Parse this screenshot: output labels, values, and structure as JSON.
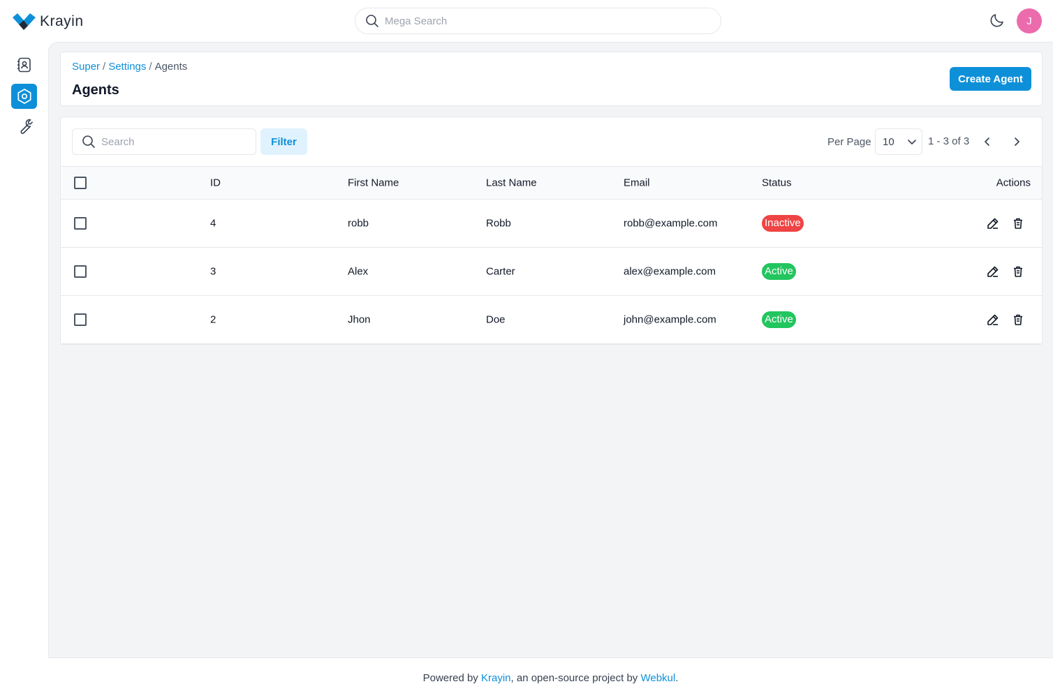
{
  "app": {
    "name": "Krayin"
  },
  "header": {
    "search_placeholder": "Mega Search",
    "avatar_initial": "J"
  },
  "sidebar": {
    "items": [
      {
        "icon": "contacts-icon",
        "active": false
      },
      {
        "icon": "settings-icon",
        "active": true
      },
      {
        "icon": "wrench-icon",
        "active": false
      }
    ]
  },
  "breadcrumb": {
    "super": "Super",
    "settings": "Settings",
    "current": "Agents",
    "separator": "/"
  },
  "page": {
    "title": "Agents",
    "create_button": "Create Agent"
  },
  "toolbar": {
    "search_placeholder": "Search",
    "filter_label": "Filter",
    "per_page_label": "Per Page",
    "per_page_value": "10",
    "page_info": "1 - 3 of 3"
  },
  "table": {
    "columns": {
      "id": "ID",
      "first_name": "First Name",
      "last_name": "Last Name",
      "email": "Email",
      "status": "Status",
      "actions": "Actions"
    },
    "rows": [
      {
        "id": "4",
        "first_name": "robb",
        "last_name": "Robb",
        "email": "robb@example.com",
        "status": "Inactive"
      },
      {
        "id": "3",
        "first_name": "Alex",
        "last_name": "Carter",
        "email": "alex@example.com",
        "status": "Active"
      },
      {
        "id": "2",
        "first_name": "Jhon",
        "last_name": "Doe",
        "email": "john@example.com",
        "status": "Active"
      }
    ]
  },
  "footer": {
    "prefix": "Powered by ",
    "krayin": "Krayin",
    "middle": ", an open-source project by ",
    "webkul": "Webkul",
    "suffix": "."
  },
  "colors": {
    "accent": "#0e90d9",
    "inactive": "#ef4444",
    "active": "#22c55e",
    "avatar": "#ec6bad"
  }
}
